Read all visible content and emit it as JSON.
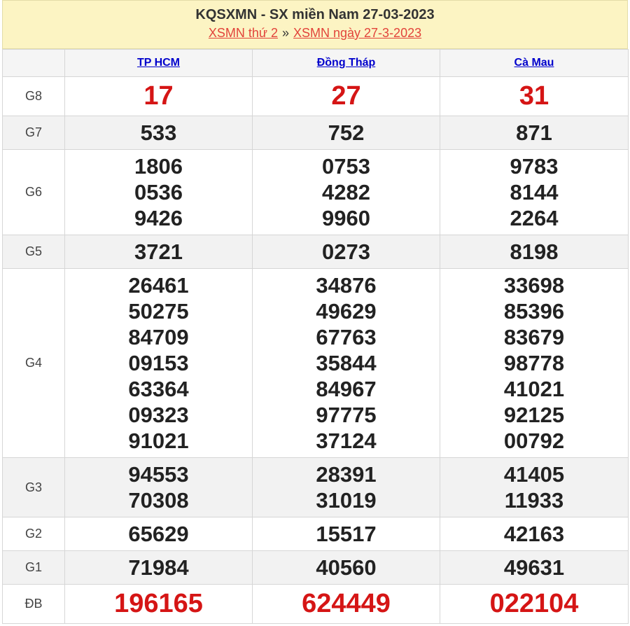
{
  "header": {
    "title": "KQSXMN - SX miền Nam 27-03-2023",
    "crumb1": "XSMN thứ 2",
    "separator": "»",
    "crumb2": "XSMN ngày 27-3-2023"
  },
  "provinces": [
    "TP HCM",
    "Đồng Tháp",
    "Cà Mau"
  ],
  "prizes": [
    {
      "label": "G8",
      "cols": [
        [
          "17"
        ],
        [
          "27"
        ],
        [
          "31"
        ]
      ]
    },
    {
      "label": "G7",
      "cols": [
        [
          "533"
        ],
        [
          "752"
        ],
        [
          "871"
        ]
      ]
    },
    {
      "label": "G6",
      "cols": [
        [
          "1806",
          "0536",
          "9426"
        ],
        [
          "0753",
          "4282",
          "9960"
        ],
        [
          "9783",
          "8144",
          "2264"
        ]
      ]
    },
    {
      "label": "G5",
      "cols": [
        [
          "3721"
        ],
        [
          "0273"
        ],
        [
          "8198"
        ]
      ]
    },
    {
      "label": "G4",
      "cols": [
        [
          "26461",
          "50275",
          "84709",
          "09153",
          "63364",
          "09323",
          "91021"
        ],
        [
          "34876",
          "49629",
          "67763",
          "35844",
          "84967",
          "97775",
          "37124"
        ],
        [
          "33698",
          "85396",
          "83679",
          "98778",
          "41021",
          "92125",
          "00792"
        ]
      ]
    },
    {
      "label": "G3",
      "cols": [
        [
          "94553",
          "70308"
        ],
        [
          "28391",
          "31019"
        ],
        [
          "41405",
          "11933"
        ]
      ]
    },
    {
      "label": "G2",
      "cols": [
        [
          "65629"
        ],
        [
          "15517"
        ],
        [
          "42163"
        ]
      ]
    },
    {
      "label": "G1",
      "cols": [
        [
          "71984"
        ],
        [
          "40560"
        ],
        [
          "49631"
        ]
      ]
    },
    {
      "label": "ĐB",
      "cols": [
        [
          "196165"
        ],
        [
          "624449"
        ],
        [
          "022104"
        ]
      ]
    }
  ],
  "colors": {
    "highlight": "#d51515",
    "link": "#0000cc",
    "crumb_link": "#e2443b",
    "header_bg": "#fcf4c3"
  }
}
